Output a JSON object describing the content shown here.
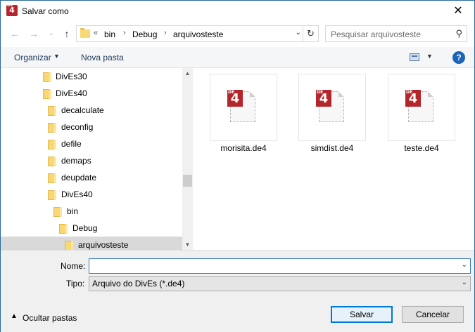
{
  "window": {
    "title": "Salvar como",
    "close_glyph": "✕"
  },
  "nav": {
    "back_glyph": "←",
    "forward_glyph": "→",
    "recent_glyph": "⌄",
    "up_glyph": "↑",
    "breadcrumb_overflow": "«",
    "breadcrumb": [
      "bin",
      "Debug",
      "arquivosteste"
    ],
    "separator": "›",
    "refresh_glyph": "↻",
    "dropdown_glyph": "⌄"
  },
  "search": {
    "placeholder": "Pesquisar arquivosteste",
    "icon": "search-icon",
    "glyph": "⚲"
  },
  "toolbar": {
    "organizar": "Organizar",
    "nova_pasta": "Nova pasta",
    "caret": "▼",
    "help": "?"
  },
  "tree": {
    "items": [
      {
        "label": "DivEs30",
        "level": 3
      },
      {
        "label": "DivEs40",
        "level": 3
      },
      {
        "label": "decalculate",
        "level": 4
      },
      {
        "label": "deconfig",
        "level": 4
      },
      {
        "label": "defile",
        "level": 4
      },
      {
        "label": "demaps",
        "level": 4
      },
      {
        "label": "deupdate",
        "level": 4
      },
      {
        "label": "DivEs40",
        "level": 4
      },
      {
        "label": "bin",
        "level": 5
      },
      {
        "label": "Debug",
        "level": 6
      },
      {
        "label": "arquivosteste",
        "level": 7,
        "selected": true
      }
    ],
    "scroll_up_glyph": "▲",
    "scroll_down_glyph": "▼"
  },
  "files": [
    {
      "name": "morisita.de4",
      "icon": "de4-file-icon"
    },
    {
      "name": "simdist.de4",
      "icon": "de4-file-icon"
    },
    {
      "name": "teste.de4",
      "icon": "de4-file-icon"
    }
  ],
  "badge": {
    "prefix": "DE",
    "digit": "4"
  },
  "form": {
    "nome_label": "Nome:",
    "nome_value": "",
    "tipo_label": "Tipo:",
    "tipo_value": "Arquivo do DivEs  (*.de4)",
    "combo_caret": "⌄"
  },
  "footer": {
    "ocultar_glyph": "▲",
    "ocultar_label": "Ocultar pastas",
    "save_label": "Salvar",
    "cancel_label": "Cancelar"
  },
  "colors": {
    "accent": "#0078d7",
    "badge": "#b3262b",
    "folder": "#f8d775",
    "link": "#1e395b"
  }
}
